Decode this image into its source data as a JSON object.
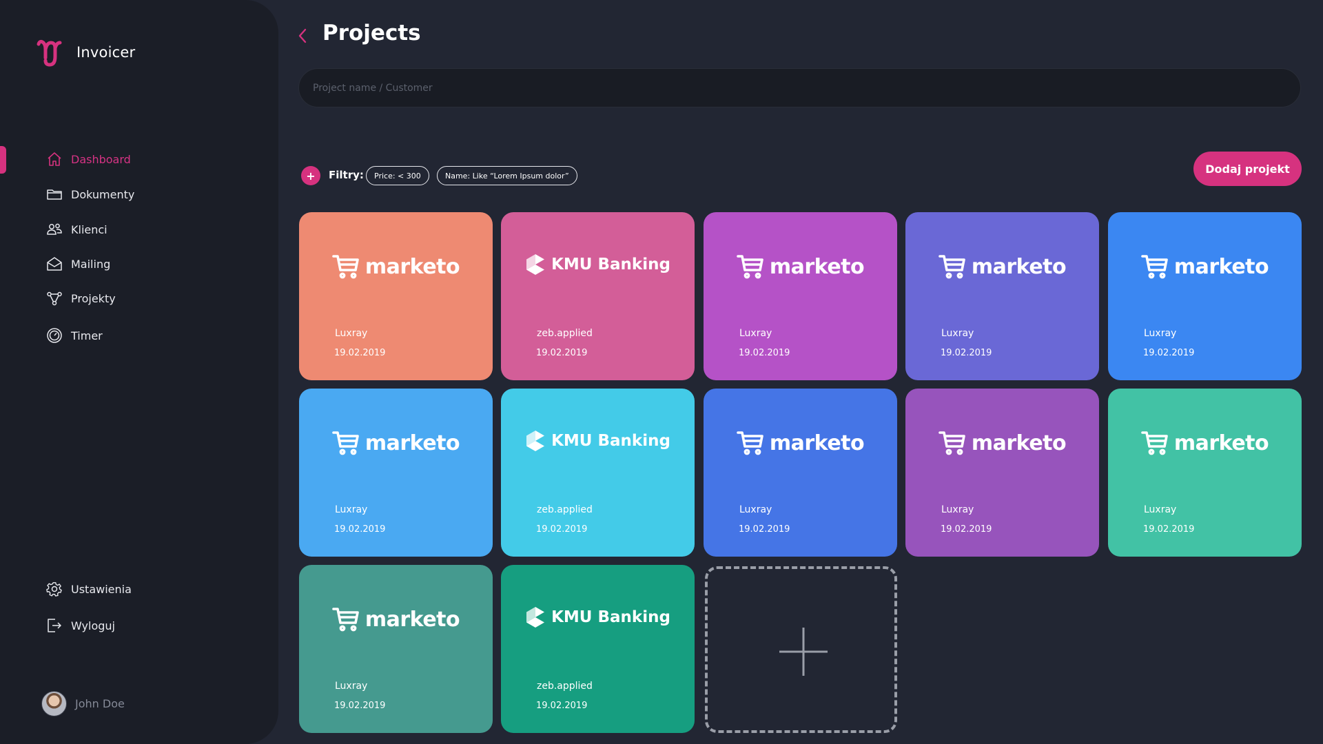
{
  "app": {
    "name": "Invoicer"
  },
  "sidebar": {
    "items": [
      {
        "label": "Dashboard",
        "icon": "home-icon"
      },
      {
        "label": "Dokumenty",
        "icon": "folder-icon"
      },
      {
        "label": "Klienci",
        "icon": "users-icon"
      },
      {
        "label": "Mailing",
        "icon": "mail-icon"
      },
      {
        "label": "Projekty",
        "icon": "project-nodes-icon"
      },
      {
        "label": "Timer",
        "icon": "timer-icon"
      }
    ],
    "bottom": [
      {
        "label": "Ustawienia",
        "icon": "gear-icon"
      },
      {
        "label": "Wyloguj",
        "icon": "logout-icon"
      }
    ],
    "user": {
      "name": "John Doe"
    }
  },
  "header": {
    "title": "Projects",
    "search_placeholder": "Project name / Customer"
  },
  "filters": {
    "label": "Filtry:",
    "add": "+",
    "chips": [
      "Price: < 300",
      "Name: Like “Lorem Ipsum dolor”"
    ]
  },
  "actions": {
    "add_project": "Dodaj projekt"
  },
  "colors": {
    "accent": "#d6327f",
    "background": "#222633",
    "sidebar": "#1b1e27"
  },
  "projects": [
    {
      "brand": "marketo",
      "client": "Luxray",
      "date": "19.02.2019",
      "color": "#ee8a72"
    },
    {
      "brand": "KMU Banking",
      "client": "zeb.applied",
      "date": "19.02.2019",
      "color": "#d35e98"
    },
    {
      "brand": "marketo",
      "client": "Luxray",
      "date": "19.02.2019",
      "color": "#b552c7"
    },
    {
      "brand": "marketo",
      "client": "Luxray",
      "date": "19.02.2019",
      "color": "#6a68d6"
    },
    {
      "brand": "marketo",
      "client": "Luxray",
      "date": "19.02.2019",
      "color": "#3b87f2"
    },
    {
      "brand": "marketo",
      "client": "Luxray",
      "date": "19.02.2019",
      "color": "#4aa9f2"
    },
    {
      "brand": "KMU Banking",
      "client": "zeb.applied",
      "date": "19.02.2019",
      "color": "#43cbe8"
    },
    {
      "brand": "marketo",
      "client": "Luxray",
      "date": "19.02.2019",
      "color": "#4575e6"
    },
    {
      "brand": "marketo",
      "client": "Luxray",
      "date": "19.02.2019",
      "color": "#9754bc"
    },
    {
      "brand": "marketo",
      "client": "Luxray",
      "date": "19.02.2019",
      "color": "#42c2a5"
    },
    {
      "brand": "marketo",
      "client": "Luxray",
      "date": "19.02.2019",
      "color": "#459a8f"
    },
    {
      "brand": "KMU Banking",
      "client": "zeb.applied",
      "date": "19.02.2019",
      "color": "#169e80"
    }
  ]
}
